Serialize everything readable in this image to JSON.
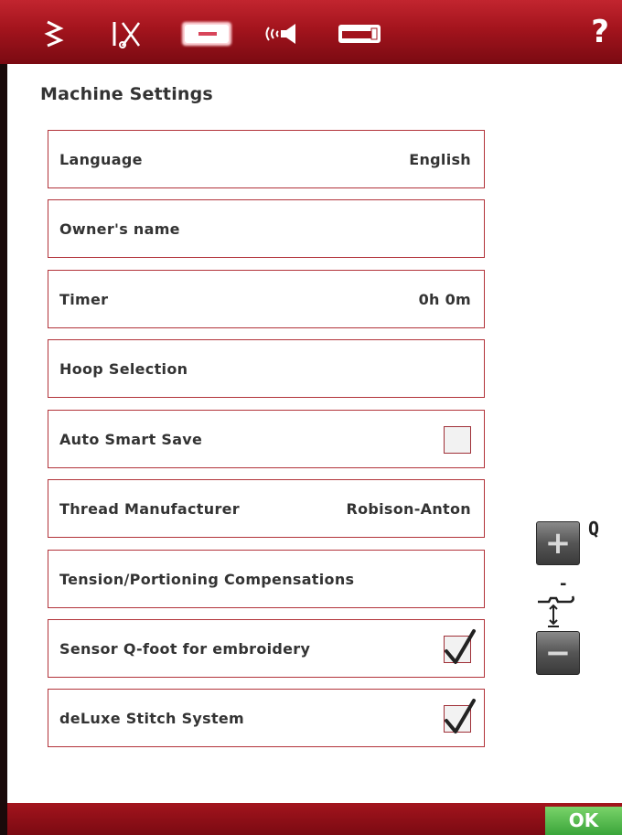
{
  "tabs": [
    {
      "name": "stitch-menu-icon"
    },
    {
      "name": "thread-scissors-icon"
    },
    {
      "name": "machine-settings-icon",
      "active": true
    },
    {
      "name": "sound-settings-icon"
    },
    {
      "name": "machine-info-icon"
    }
  ],
  "help_label": "?",
  "title": "Machine Settings",
  "rows": {
    "language": {
      "label": "Language",
      "value": "English"
    },
    "owner": {
      "label": "Owner's name"
    },
    "timer": {
      "label": "Timer",
      "value": "0h 0m"
    },
    "hoop": {
      "label": "Hoop Selection"
    },
    "autosave": {
      "label": "Auto Smart Save",
      "checked": false
    },
    "thread": {
      "label": "Thread Manufacturer",
      "value": "Robison-Anton"
    },
    "tension": {
      "label": "Tension/Portioning Compensations"
    },
    "sensor": {
      "label": "Sensor Q-foot for embroidery",
      "checked": true
    },
    "deluxe": {
      "label": "deLuxe Stitch System",
      "checked": true
    }
  },
  "presser_foot": {
    "q_label": "Q",
    "minus_label": "-",
    "plus_symbol": "+",
    "minus_symbol": "−"
  },
  "ok_label": "OK",
  "colors": {
    "accent_red": "#a3141d",
    "row_border": "#b2333a",
    "ok_green": "#4fb34a"
  }
}
